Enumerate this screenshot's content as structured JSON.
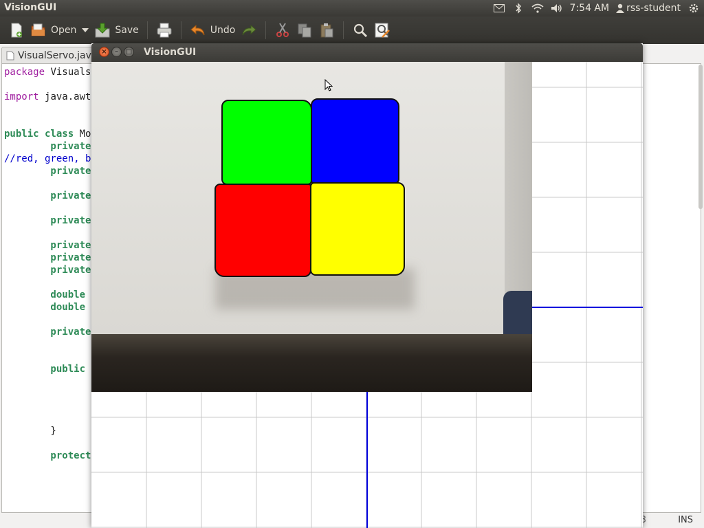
{
  "panel": {
    "app_title": "VisionGUI",
    "clock": "7:54 AM",
    "user": "rss-student",
    "icons": [
      "mail-icon",
      "bluetooth-icon",
      "wifi-icon",
      "volume-icon",
      "user-icon",
      "settings-gear-icon"
    ]
  },
  "toolbar": {
    "new_icon": "new-document-icon",
    "open_label": "Open",
    "save_label": "Save",
    "print_icon": "print-icon",
    "undo_label": "Undo",
    "redo_icon": "redo-icon",
    "cut_icon": "cut-icon",
    "copy_icon": "copy-icon",
    "paste_icon": "paste-icon",
    "find_icon": "search-icon",
    "replace_icon": "find-replace-icon"
  },
  "editor": {
    "tab_label": "VisualServo.java",
    "lines": [
      {
        "parts": [
          {
            "t": "package ",
            "c": "kw"
          },
          {
            "t": "Visuals",
            "c": "tx"
          }
        ]
      },
      {
        "parts": [
          {
            "t": "",
            "c": "tx"
          }
        ]
      },
      {
        "parts": [
          {
            "t": "import ",
            "c": "kw"
          },
          {
            "t": "java.awt",
            "c": "tx"
          }
        ]
      },
      {
        "parts": [
          {
            "t": "",
            "c": "tx"
          }
        ]
      },
      {
        "parts": [
          {
            "t": "",
            "c": "tx"
          }
        ]
      },
      {
        "parts": [
          {
            "t": "public class ",
            "c": "kw2"
          },
          {
            "t": "Mo",
            "c": "tx"
          }
        ]
      },
      {
        "parts": [
          {
            "t": "        private",
            "c": "kw2"
          }
        ]
      },
      {
        "parts": [
          {
            "t": "//red, green, b",
            "c": "cm"
          }
        ]
      },
      {
        "parts": [
          {
            "t": "        private",
            "c": "kw2"
          }
        ]
      },
      {
        "parts": [
          {
            "t": "",
            "c": "tx"
          }
        ]
      },
      {
        "parts": [
          {
            "t": "        private",
            "c": "kw2"
          }
        ]
      },
      {
        "parts": [
          {
            "t": "",
            "c": "tx"
          }
        ]
      },
      {
        "parts": [
          {
            "t": "        private",
            "c": "kw2"
          }
        ]
      },
      {
        "parts": [
          {
            "t": "",
            "c": "tx"
          }
        ]
      },
      {
        "parts": [
          {
            "t": "        private",
            "c": "kw2"
          }
        ]
      },
      {
        "parts": [
          {
            "t": "        private",
            "c": "kw2"
          }
        ]
      },
      {
        "parts": [
          {
            "t": "        private",
            "c": "kw2"
          }
        ]
      },
      {
        "parts": [
          {
            "t": "",
            "c": "tx"
          }
        ]
      },
      {
        "parts": [
          {
            "t": "        double",
            "c": "kw2"
          }
        ]
      },
      {
        "parts": [
          {
            "t": "        double",
            "c": "kw2"
          }
        ]
      },
      {
        "parts": [
          {
            "t": "",
            "c": "tx"
          }
        ]
      },
      {
        "parts": [
          {
            "t": "        private",
            "c": "kw2"
          }
        ]
      },
      {
        "parts": [
          {
            "t": "",
            "c": "tx"
          }
        ]
      },
      {
        "parts": [
          {
            "t": "",
            "c": "tx"
          }
        ]
      },
      {
        "parts": [
          {
            "t": "        public",
            "c": "kw2"
          }
        ]
      },
      {
        "parts": [
          {
            "t": "",
            "c": "tx"
          }
        ]
      },
      {
        "parts": [
          {
            "t": "",
            "c": "tx"
          }
        ]
      },
      {
        "parts": [
          {
            "t": "",
            "c": "tx"
          }
        ]
      },
      {
        "parts": [
          {
            "t": "",
            "c": "tx"
          }
        ]
      },
      {
        "parts": [
          {
            "t": "        }",
            "c": "tx"
          }
        ]
      },
      {
        "parts": [
          {
            "t": "",
            "c": "tx"
          }
        ]
      },
      {
        "parts": [
          {
            "t": "        protect",
            "c": "kw2"
          }
        ]
      }
    ],
    "status_partial": "3",
    "status_mode": "INS"
  },
  "vision_window": {
    "title": "VisionGUI",
    "close_glyph": "×",
    "min_glyph": "–",
    "max_glyph": "□",
    "blob_colors": {
      "green": "#00ff00",
      "blue": "#0000ff",
      "red": "#ff0000",
      "yellow": "#ffff00"
    },
    "axis_color": "#0000dd"
  }
}
